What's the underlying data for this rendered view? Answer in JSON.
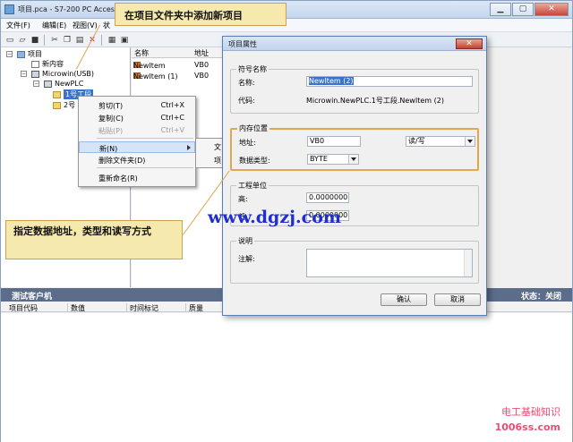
{
  "window": {
    "title": "项目.pca - S7-200 PC Access"
  },
  "menubar": [
    "文件(F)",
    "编辑(E)",
    "视图(V)",
    "状"
  ],
  "tree": {
    "root": "项目",
    "items": [
      "新内容",
      "Microwin(USB)",
      "NewPLC",
      "1号工段",
      "2号"
    ]
  },
  "list": {
    "headers": [
      "名称",
      "地址"
    ],
    "rows": [
      {
        "name": "NewItem",
        "addr": "VB0"
      },
      {
        "name": "NewItem (1)",
        "addr": "VB0"
      }
    ]
  },
  "context_menu": {
    "items": [
      {
        "label": "剪切(T)",
        "key": "Ctrl+X",
        "enabled": true
      },
      {
        "label": "复制(C)",
        "key": "Ctrl+C",
        "enabled": true
      },
      {
        "label": "粘贴(P)",
        "key": "Ctrl+V",
        "enabled": false
      },
      {
        "label": "新(N)",
        "key": "",
        "enabled": true
      },
      {
        "label": "删除文件夹(D)",
        "key": "",
        "enabled": true
      },
      {
        "label": "重新命名(R)",
        "key": "",
        "enabled": true
      }
    ],
    "submenu": [
      "文",
      "项"
    ]
  },
  "client": {
    "title": "测试客户机",
    "status": "状态：关闭",
    "columns": [
      "项目代码",
      "数值",
      "时间标记",
      "质量"
    ]
  },
  "dialog": {
    "title": "项目属性",
    "close": "✕",
    "symbol_group": "符号名称",
    "name_label": "名称:",
    "name_value": "NewItem (2)",
    "code_label": "代码:",
    "code_value": "Microwin.NewPLC.1号工段.NewItem (2)",
    "memory_group": "内存位置",
    "address_label": "地址:",
    "address_value": "VB0",
    "access_value": "读/写",
    "datatype_label": "数据类型:",
    "datatype_value": "BYTE",
    "eng_group": "工程单位",
    "high_label": "高:",
    "high_value": "0.0000000",
    "low_label": "低:",
    "low_value": "0.0000000",
    "desc_group": "说明",
    "comment_label": "注解:",
    "ok": "确认",
    "cancel": "取消"
  },
  "callouts": {
    "top": "在项目文件夹中添加新项目",
    "middle": "指定数据地址，类型和读写方式"
  },
  "watermark": "www.dgzj.com",
  "corner_logo": "电工基础知识",
  "corner_site": "1006ss.com",
  "colors": {
    "callout_bg": "#f6e9ad",
    "highlight": "#e1a74d",
    "client_bar": "#5b6d8b",
    "watermark": "#1f2fcf"
  }
}
